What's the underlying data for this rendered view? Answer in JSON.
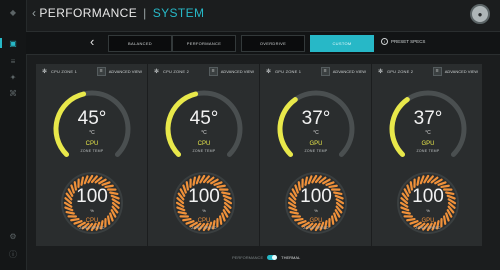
{
  "header": {
    "title": "PERFORMANCE",
    "section": "SYSTEM",
    "window_controls": [
      "–",
      "□",
      "✕"
    ]
  },
  "sidebar": {
    "icons": [
      "logo-icon",
      "monitor-icon",
      "sliders-icon",
      "lighting-icon",
      "macro-icon",
      "game-icon",
      "settings-icon",
      "info-icon"
    ]
  },
  "tabs": [
    {
      "label": "BALANCED",
      "active": false
    },
    {
      "label": "PERFORMANCE",
      "active": false
    },
    {
      "label": "OVERDRIVE",
      "active": false
    },
    {
      "label": "CUSTOM",
      "active": true
    }
  ],
  "preset_specs_label": "PRESET SPECS",
  "zones": [
    {
      "zone_label": "CPU ZONE 1",
      "advanced_label": "ADVANCED VIEW",
      "temp": {
        "value": "45°",
        "unit": "°C",
        "source": "CPU",
        "label": "ZONE TEMP",
        "fraction": 0.45
      },
      "speed": {
        "value": "100",
        "unit": "%",
        "source": "CPU",
        "label": "ZONE SPEED",
        "fraction": 1.0
      }
    },
    {
      "zone_label": "CPU ZONE 2",
      "advanced_label": "ADVANCED VIEW",
      "temp": {
        "value": "45°",
        "unit": "°C",
        "source": "CPU",
        "label": "ZONE TEMP",
        "fraction": 0.45
      },
      "speed": {
        "value": "100",
        "unit": "%",
        "source": "CPU",
        "label": "ZONE SPEED",
        "fraction": 1.0
      }
    },
    {
      "zone_label": "GPU ZONE 1",
      "advanced_label": "ADVANCED VIEW",
      "temp": {
        "value": "37°",
        "unit": "°C",
        "source": "GPU",
        "label": "ZONE TEMP",
        "fraction": 0.37
      },
      "speed": {
        "value": "100",
        "unit": "%",
        "source": "GPU",
        "label": "ZONE SPEED",
        "fraction": 1.0
      }
    },
    {
      "zone_label": "GPU ZONE 2",
      "advanced_label": "ADVANCED VIEW",
      "temp": {
        "value": "37°",
        "unit": "°C",
        "source": "GPU",
        "label": "ZONE TEMP",
        "fraction": 0.37
      },
      "speed": {
        "value": "100",
        "unit": "%",
        "source": "GPU",
        "label": "ZONE SPEED",
        "fraction": 1.0
      }
    }
  ],
  "footer": {
    "mode_off_label": "PERFORMANCE",
    "mode_on_label": "THERMAL",
    "thermal_enabled": true
  },
  "colors": {
    "accent": "#27b8c7",
    "temp_arc": "#e8e84a",
    "speed_ring": "#f0913a",
    "background": "#1b1d1e",
    "panel": "#2a2d2e"
  }
}
